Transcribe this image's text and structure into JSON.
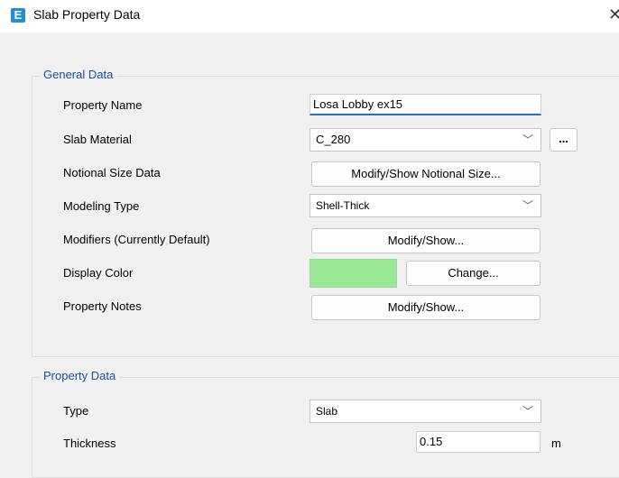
{
  "window": {
    "title": "Slab Property Data",
    "icon_letter": "E",
    "close_glyph": "✕"
  },
  "general": {
    "title": "General Data",
    "property_name_label": "Property Name",
    "property_name_value": "Losa Lobby ex15",
    "slab_material_label": "Slab Material",
    "slab_material_value": "C_280",
    "material_dots": "...",
    "notional_label": "Notional Size Data",
    "notional_button": "Modify/Show Notional Size...",
    "modeling_label": "Modeling Type",
    "modeling_value": "Shell-Thick",
    "modifiers_label": "Modifiers (Currently Default)",
    "modifiers_button": "Modify/Show...",
    "color_label": "Display Color",
    "color_value": "#98e898",
    "color_button": "Change...",
    "notes_label": "Property Notes",
    "notes_button": "Modify/Show..."
  },
  "property": {
    "title": "Property Data",
    "type_label": "Type",
    "type_value": "Slab",
    "thickness_label": "Thickness",
    "thickness_value": "0.15",
    "thickness_unit": "m"
  }
}
